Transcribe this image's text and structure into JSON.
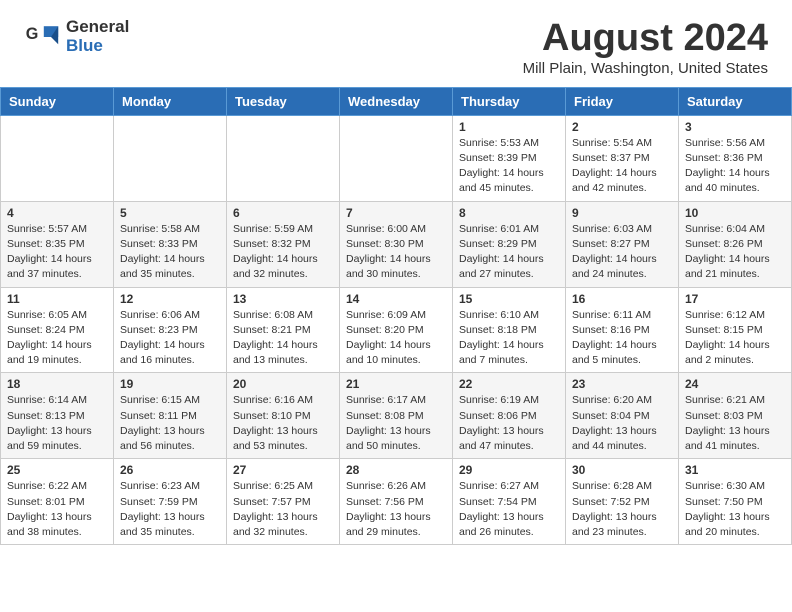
{
  "header": {
    "logo_general": "General",
    "logo_blue": "Blue",
    "title": "August 2024",
    "location": "Mill Plain, Washington, United States"
  },
  "weekdays": [
    "Sunday",
    "Monday",
    "Tuesday",
    "Wednesday",
    "Thursday",
    "Friday",
    "Saturday"
  ],
  "weeks": [
    [
      {
        "day": "",
        "info": ""
      },
      {
        "day": "",
        "info": ""
      },
      {
        "day": "",
        "info": ""
      },
      {
        "day": "",
        "info": ""
      },
      {
        "day": "1",
        "info": "Sunrise: 5:53 AM\nSunset: 8:39 PM\nDaylight: 14 hours\nand 45 minutes."
      },
      {
        "day": "2",
        "info": "Sunrise: 5:54 AM\nSunset: 8:37 PM\nDaylight: 14 hours\nand 42 minutes."
      },
      {
        "day": "3",
        "info": "Sunrise: 5:56 AM\nSunset: 8:36 PM\nDaylight: 14 hours\nand 40 minutes."
      }
    ],
    [
      {
        "day": "4",
        "info": "Sunrise: 5:57 AM\nSunset: 8:35 PM\nDaylight: 14 hours\nand 37 minutes."
      },
      {
        "day": "5",
        "info": "Sunrise: 5:58 AM\nSunset: 8:33 PM\nDaylight: 14 hours\nand 35 minutes."
      },
      {
        "day": "6",
        "info": "Sunrise: 5:59 AM\nSunset: 8:32 PM\nDaylight: 14 hours\nand 32 minutes."
      },
      {
        "day": "7",
        "info": "Sunrise: 6:00 AM\nSunset: 8:30 PM\nDaylight: 14 hours\nand 30 minutes."
      },
      {
        "day": "8",
        "info": "Sunrise: 6:01 AM\nSunset: 8:29 PM\nDaylight: 14 hours\nand 27 minutes."
      },
      {
        "day": "9",
        "info": "Sunrise: 6:03 AM\nSunset: 8:27 PM\nDaylight: 14 hours\nand 24 minutes."
      },
      {
        "day": "10",
        "info": "Sunrise: 6:04 AM\nSunset: 8:26 PM\nDaylight: 14 hours\nand 21 minutes."
      }
    ],
    [
      {
        "day": "11",
        "info": "Sunrise: 6:05 AM\nSunset: 8:24 PM\nDaylight: 14 hours\nand 19 minutes."
      },
      {
        "day": "12",
        "info": "Sunrise: 6:06 AM\nSunset: 8:23 PM\nDaylight: 14 hours\nand 16 minutes."
      },
      {
        "day": "13",
        "info": "Sunrise: 6:08 AM\nSunset: 8:21 PM\nDaylight: 14 hours\nand 13 minutes."
      },
      {
        "day": "14",
        "info": "Sunrise: 6:09 AM\nSunset: 8:20 PM\nDaylight: 14 hours\nand 10 minutes."
      },
      {
        "day": "15",
        "info": "Sunrise: 6:10 AM\nSunset: 8:18 PM\nDaylight: 14 hours\nand 7 minutes."
      },
      {
        "day": "16",
        "info": "Sunrise: 6:11 AM\nSunset: 8:16 PM\nDaylight: 14 hours\nand 5 minutes."
      },
      {
        "day": "17",
        "info": "Sunrise: 6:12 AM\nSunset: 8:15 PM\nDaylight: 14 hours\nand 2 minutes."
      }
    ],
    [
      {
        "day": "18",
        "info": "Sunrise: 6:14 AM\nSunset: 8:13 PM\nDaylight: 13 hours\nand 59 minutes."
      },
      {
        "day": "19",
        "info": "Sunrise: 6:15 AM\nSunset: 8:11 PM\nDaylight: 13 hours\nand 56 minutes."
      },
      {
        "day": "20",
        "info": "Sunrise: 6:16 AM\nSunset: 8:10 PM\nDaylight: 13 hours\nand 53 minutes."
      },
      {
        "day": "21",
        "info": "Sunrise: 6:17 AM\nSunset: 8:08 PM\nDaylight: 13 hours\nand 50 minutes."
      },
      {
        "day": "22",
        "info": "Sunrise: 6:19 AM\nSunset: 8:06 PM\nDaylight: 13 hours\nand 47 minutes."
      },
      {
        "day": "23",
        "info": "Sunrise: 6:20 AM\nSunset: 8:04 PM\nDaylight: 13 hours\nand 44 minutes."
      },
      {
        "day": "24",
        "info": "Sunrise: 6:21 AM\nSunset: 8:03 PM\nDaylight: 13 hours\nand 41 minutes."
      }
    ],
    [
      {
        "day": "25",
        "info": "Sunrise: 6:22 AM\nSunset: 8:01 PM\nDaylight: 13 hours\nand 38 minutes."
      },
      {
        "day": "26",
        "info": "Sunrise: 6:23 AM\nSunset: 7:59 PM\nDaylight: 13 hours\nand 35 minutes."
      },
      {
        "day": "27",
        "info": "Sunrise: 6:25 AM\nSunset: 7:57 PM\nDaylight: 13 hours\nand 32 minutes."
      },
      {
        "day": "28",
        "info": "Sunrise: 6:26 AM\nSunset: 7:56 PM\nDaylight: 13 hours\nand 29 minutes."
      },
      {
        "day": "29",
        "info": "Sunrise: 6:27 AM\nSunset: 7:54 PM\nDaylight: 13 hours\nand 26 minutes."
      },
      {
        "day": "30",
        "info": "Sunrise: 6:28 AM\nSunset: 7:52 PM\nDaylight: 13 hours\nand 23 minutes."
      },
      {
        "day": "31",
        "info": "Sunrise: 6:30 AM\nSunset: 7:50 PM\nDaylight: 13 hours\nand 20 minutes."
      }
    ]
  ]
}
